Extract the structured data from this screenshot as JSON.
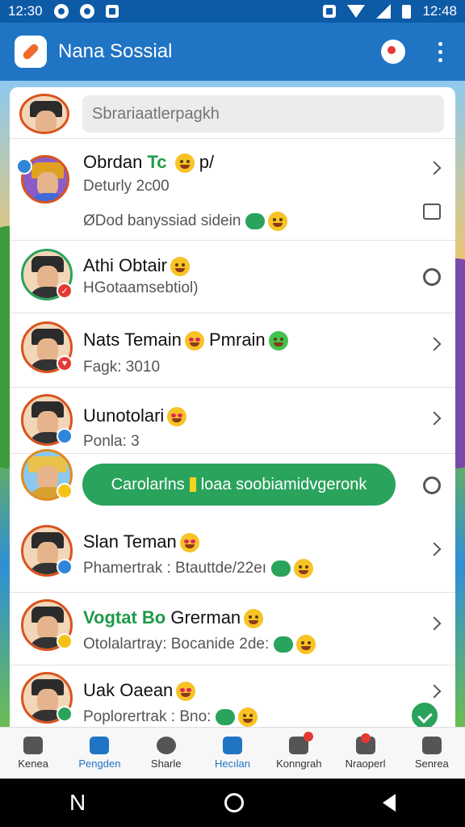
{
  "status_bar": {
    "time": "12:30",
    "battery_time": "12:48"
  },
  "app": {
    "title": "Nana Sossial"
  },
  "compose": {
    "placeholder": "Sbrariaatlerpagkh"
  },
  "feed": [
    {
      "name": "Obrdan ",
      "name_accent": "Tc",
      "name_suffix": " p/",
      "sub1": "Deturly 2c00",
      "sub2": "ØDod banyssiad sidein"
    },
    {
      "name": "Athi Obtair",
      "sub1": "HGotaamsebtiol)"
    },
    {
      "name": "Nats Temain",
      "name_suffix": " Pmrain",
      "sub1": "Fagk: 3010"
    },
    {
      "name": "Uunotolari",
      "sub1": "Ponla: 3"
    },
    {
      "highlight": "Carolarlns",
      "highlight_suffix": "loaa soobiamidvgeronk"
    },
    {
      "name": "Slan Teman",
      "sub1": "Phamertrak : Btauttde/22eı"
    },
    {
      "name_accent": "Vogtat Bo",
      "name": " Grerman",
      "sub1": "Otolalartray: Bocanide 2de:"
    },
    {
      "name": "Uak Oaean",
      "sub1": "Poplorertrak : Bno:"
    }
  ],
  "bottom_nav": [
    {
      "label": "Kenea",
      "active": false
    },
    {
      "label": "Pengden",
      "active": true
    },
    {
      "label": "Sharle",
      "active": false
    },
    {
      "label": "Hecılan",
      "active": true
    },
    {
      "label": "Konngrah",
      "active": false
    },
    {
      "label": "Nraoperl",
      "active": false
    },
    {
      "label": "Senrea",
      "active": false
    }
  ],
  "icons": [
    "search-icon",
    "more-icon",
    "chevron-right-icon",
    "home-icon"
  ],
  "colors": {
    "primary": "#1f74c4",
    "accent_green": "#2aa35c",
    "avatar_ring": "#d9531e"
  }
}
